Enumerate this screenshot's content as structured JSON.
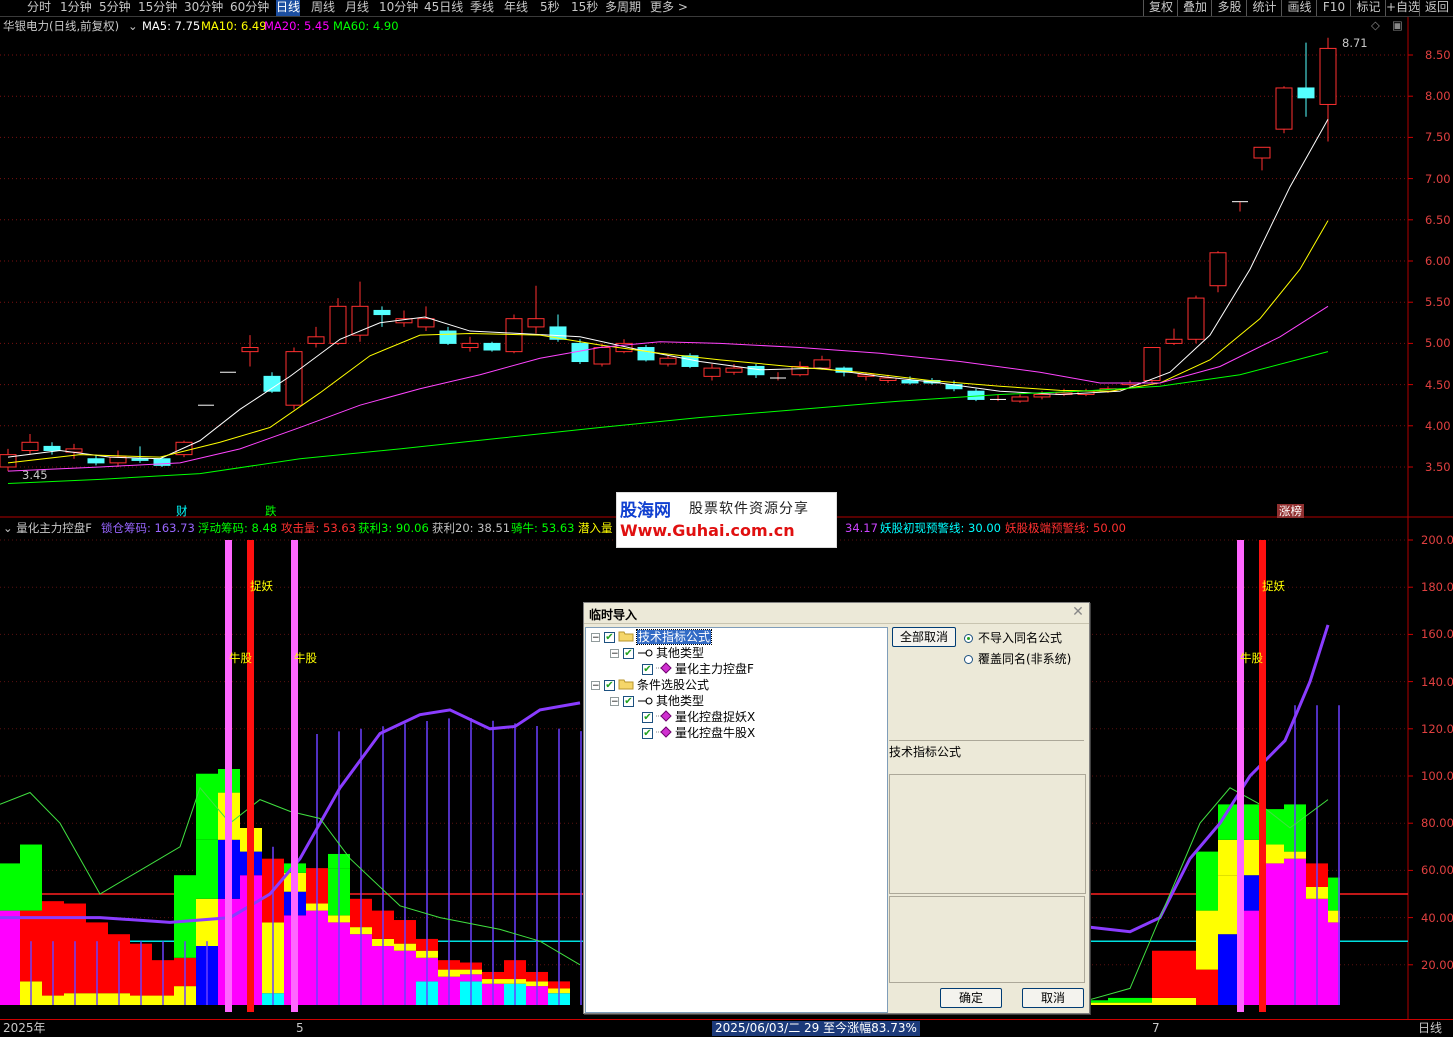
{
  "toolbar": {
    "periods": [
      "分时",
      "1分钟",
      "5分钟",
      "15分钟",
      "30分钟",
      "60分钟",
      "日线",
      "周线",
      "月线",
      "10分钟",
      "45日线",
      "季线",
      "年线",
      "5秒",
      "15秒",
      "多周期",
      "更多 >"
    ],
    "active_period": "日线",
    "right_buttons": [
      "复权",
      "叠加",
      "多股",
      "统计",
      "画线",
      "F10",
      "标记",
      "+自选",
      "返回"
    ]
  },
  "main_chart": {
    "title": "华银电力(日线,前复权)",
    "ma": [
      {
        "label": "MA5: 7.75",
        "color": "#ffffff"
      },
      {
        "label": "MA10: 6.49",
        "color": "#ffff00"
      },
      {
        "label": "MA20: 5.45",
        "color": "#ff00ff"
      },
      {
        "label": "MA60: 4.90",
        "color": "#00ff00"
      }
    ],
    "price_high_label": "8.71",
    "price_low_label": "3.45",
    "y_ticks": [
      "8.50",
      "8.00",
      "7.50",
      "7.00",
      "6.50",
      "6.00",
      "5.50",
      "5.00",
      "4.50",
      "4.00",
      "3.50"
    ],
    "markers": {
      "cai": "财",
      "die": "跌",
      "zhangbang": "涨榜"
    }
  },
  "indicator": {
    "name": "量化主力控盘F",
    "legend": [
      {
        "label": "锁仓筹码: 163.73",
        "color": "#9966ff"
      },
      {
        "label": "浮动筹码: 8.48",
        "color": "#00ff00"
      },
      {
        "label": "攻击量: 53.63",
        "color": "#ff3030"
      },
      {
        "label": "获利3: 90.06",
        "color": "#00ff00"
      },
      {
        "label": "获利20: 38.51",
        "color": "#c0c0c0"
      },
      {
        "label": "骑牛: 53.63",
        "color": "#00ff00"
      },
      {
        "label": "潜入量",
        "color": "#ffff00"
      },
      {
        "label": "34.17",
        "color": "#cc44ff"
      },
      {
        "label": "妖股初现预警线: 30.00",
        "color": "#00ffff"
      },
      {
        "label": "妖股极端预警线: 50.00",
        "color": "#ff3030"
      }
    ],
    "y_ticks": [
      "200.00",
      "180.00",
      "160.00",
      "140.00",
      "120.00",
      "100.00",
      "80.00",
      "60.00",
      "40.00",
      "20.00"
    ],
    "labels": {
      "zhuoyao": "捉妖",
      "niugu": "牛股"
    }
  },
  "watermark": {
    "line1": "股海网",
    "line2": "股票软件资源分享",
    "line3": "Www.Guhai.com.cn"
  },
  "dialog": {
    "title": "临时导入",
    "tree": [
      {
        "label": "技术指标公式",
        "level": 0,
        "type": "folder",
        "selected": true
      },
      {
        "label": "其他类型",
        "level": 1,
        "type": "key"
      },
      {
        "label": "量化主力控盘F",
        "level": 2,
        "type": "item"
      },
      {
        "label": "条件选股公式",
        "level": 0,
        "type": "folder"
      },
      {
        "label": "其他类型",
        "level": 1,
        "type": "key"
      },
      {
        "label": "量化控盘捉妖X",
        "level": 2,
        "type": "item"
      },
      {
        "label": "量化控盘牛股X",
        "level": 2,
        "type": "item"
      }
    ],
    "cancel_all_label": "全部取消",
    "radio_no_import": "不导入同名公式",
    "radio_overwrite": "覆盖同名(非系统)",
    "info_label": "技术指标公式",
    "ok_label": "确定",
    "cancel_label": "取消"
  },
  "status": {
    "year": "2025年",
    "month5": "5",
    "month7": "7",
    "range_info": "2025/06/03/二 29 至今涨幅83.73%",
    "period": "日线"
  }
}
